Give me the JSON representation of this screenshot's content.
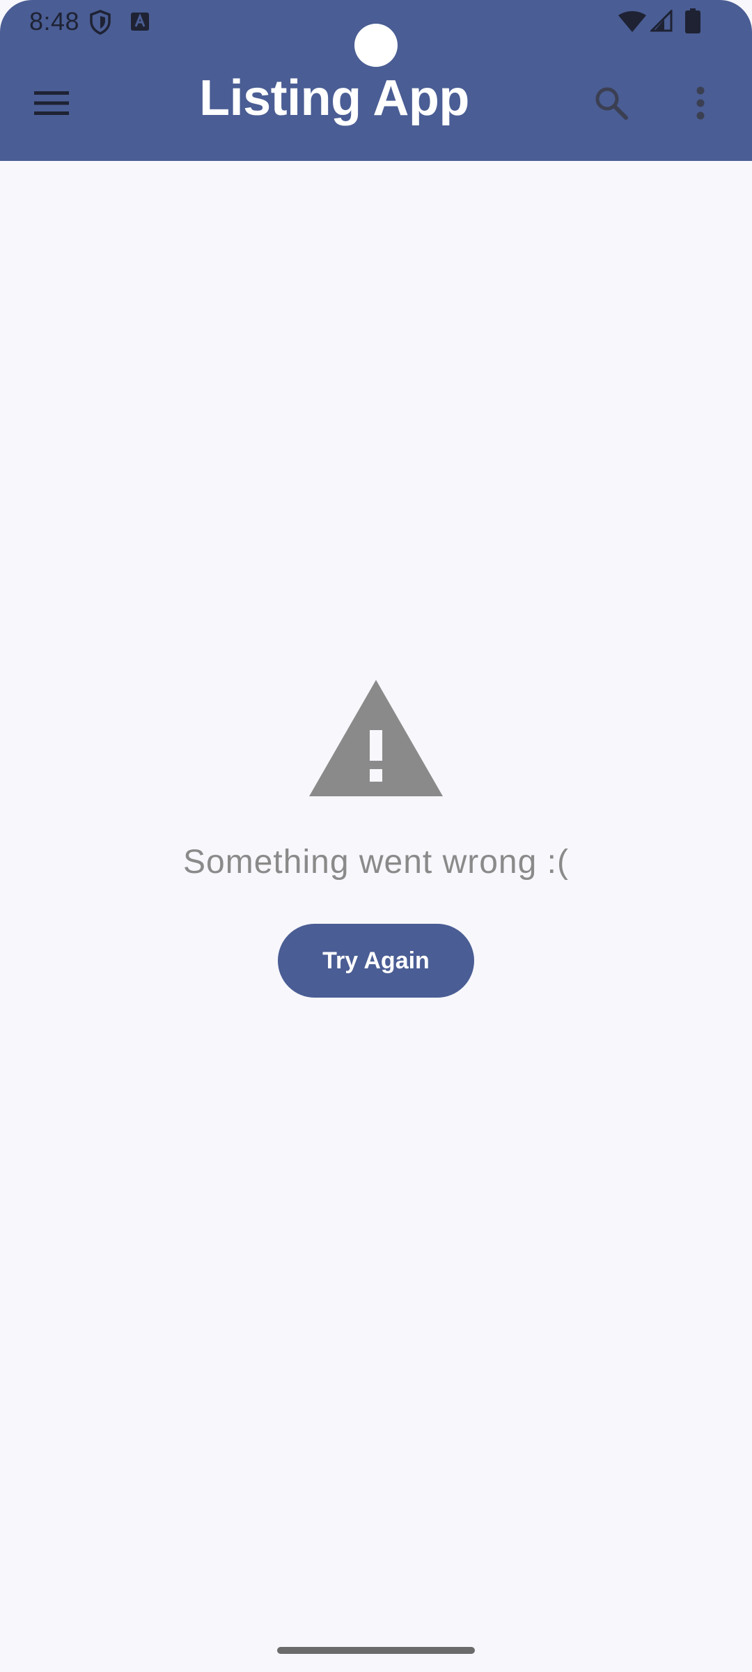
{
  "status_bar": {
    "time": "8:48",
    "icons": [
      "shield-icon",
      "text-a-icon",
      "wifi-icon",
      "signal-icon",
      "battery-icon"
    ]
  },
  "app_bar": {
    "title": "Listing App",
    "icons": [
      "menu-icon",
      "search-icon",
      "more-vert-icon"
    ],
    "background_color": "#4a5d94"
  },
  "error_state": {
    "icon": "warning-icon",
    "message": "Something went wrong :(",
    "retry_label": "Try Again",
    "icon_color": "#8a8a8a",
    "accent_color": "#4a5d94"
  }
}
